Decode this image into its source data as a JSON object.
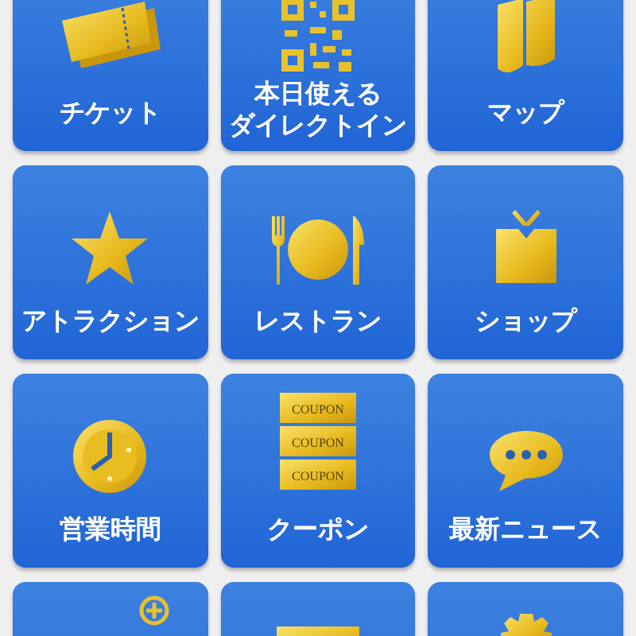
{
  "tiles": [
    {
      "kind": "ticket",
      "lines": [
        "チケット"
      ]
    },
    {
      "kind": "qr",
      "lines": [
        "本日使える",
        "ダイレクトイン"
      ]
    },
    {
      "kind": "map",
      "lines": [
        "マップ"
      ]
    },
    {
      "kind": "star",
      "lines": [
        "アトラクション"
      ]
    },
    {
      "kind": "restaurant",
      "lines": [
        "レストラン"
      ]
    },
    {
      "kind": "gift",
      "lines": [
        "ショップ"
      ]
    },
    {
      "kind": "clock",
      "lines": [
        "営業時間"
      ]
    },
    {
      "kind": "coupon",
      "lines": [
        "クーポン"
      ],
      "icon_texts": [
        "COUPON",
        "COUPON",
        "COUPON"
      ]
    },
    {
      "kind": "chat",
      "lines": [
        "最新ニュース"
      ]
    },
    {
      "kind": "plus"
    },
    {
      "kind": "card"
    },
    {
      "kind": "gear"
    }
  ]
}
